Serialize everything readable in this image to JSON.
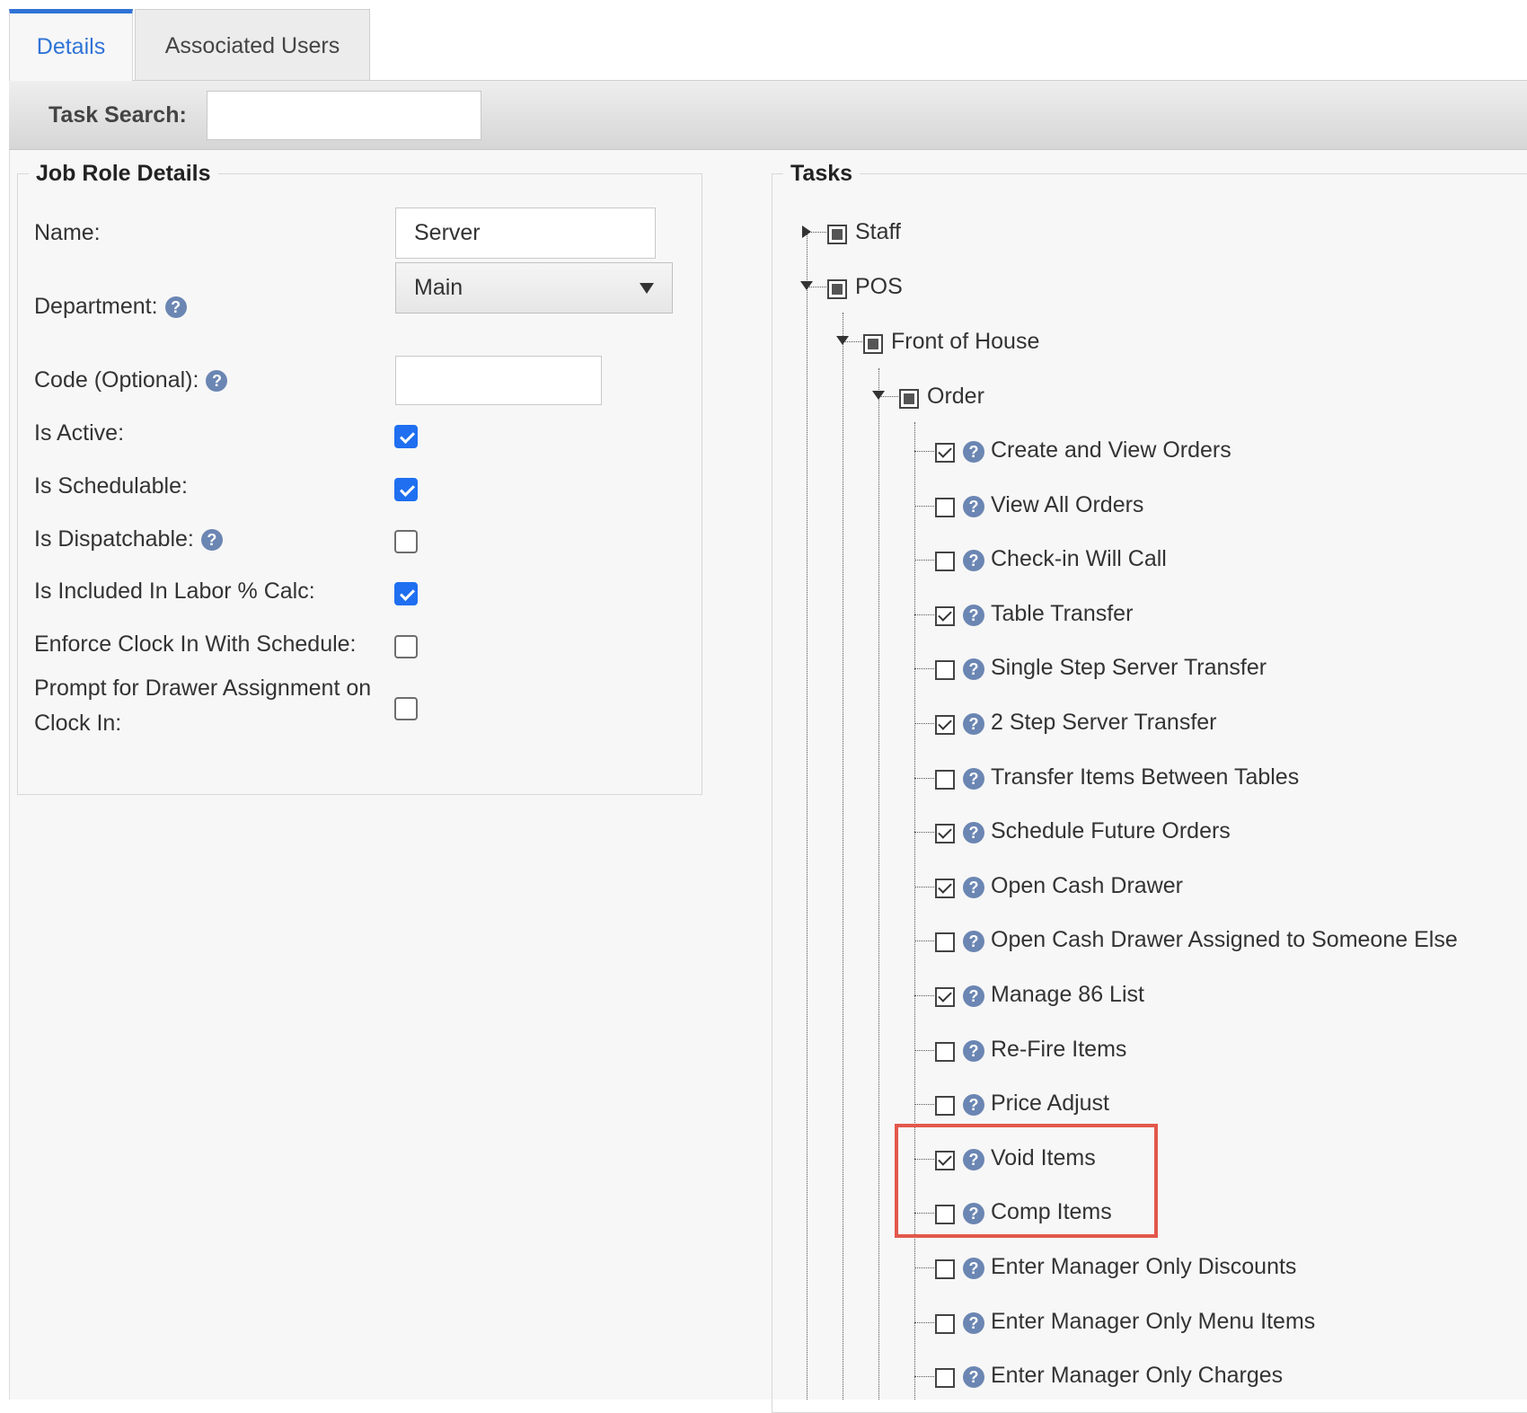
{
  "tabs": [
    {
      "label": "Details",
      "active": true
    },
    {
      "label": "Associated Users",
      "active": false
    }
  ],
  "search": {
    "label": "Task Search:",
    "value": ""
  },
  "job_role": {
    "legend": "Job Role Details",
    "name": {
      "label": "Name:",
      "value": "Server"
    },
    "department": {
      "label": "Department:",
      "value": "Main"
    },
    "code": {
      "label": "Code (Optional):",
      "value": ""
    },
    "flags": [
      {
        "label": "Is Active:",
        "checked": true
      },
      {
        "label": "Is Schedulable:",
        "checked": true
      },
      {
        "label": "Is Dispatchable:",
        "checked": false,
        "help": true
      },
      {
        "label": "Is Included In Labor % Calc:",
        "checked": true
      },
      {
        "label": "Enforce Clock In With Schedule:",
        "checked": false
      },
      {
        "label": "Prompt for Drawer Assignment on Clock In:",
        "checked": false
      }
    ]
  },
  "tasks": {
    "legend": "Tasks",
    "staff": "Staff",
    "pos": "POS",
    "front_of_house": "Front of House",
    "order": "Order",
    "items": [
      {
        "label": "Create and View Orders",
        "checked": true
      },
      {
        "label": "View All Orders",
        "checked": false
      },
      {
        "label": "Check-in Will Call",
        "checked": false
      },
      {
        "label": "Table Transfer",
        "checked": true
      },
      {
        "label": "Single Step Server Transfer",
        "checked": false
      },
      {
        "label": "2 Step Server Transfer",
        "checked": true
      },
      {
        "label": "Transfer Items Between Tables",
        "checked": false
      },
      {
        "label": "Schedule Future Orders",
        "checked": true
      },
      {
        "label": "Open Cash Drawer",
        "checked": true
      },
      {
        "label": "Open Cash Drawer Assigned to Someone Else",
        "checked": false
      },
      {
        "label": "Manage 86 List",
        "checked": true
      },
      {
        "label": "Re-Fire Items",
        "checked": false
      },
      {
        "label": "Price Adjust",
        "checked": false
      },
      {
        "label": "Void Items",
        "checked": true
      },
      {
        "label": "Comp Items",
        "checked": false
      },
      {
        "label": "Enter Manager Only Discounts",
        "checked": false
      },
      {
        "label": "Enter Manager Only Menu Items",
        "checked": false
      },
      {
        "label": "Enter Manager Only Charges",
        "checked": false
      }
    ]
  },
  "colors": {
    "accent": "#2f73d6",
    "checkbox_on": "#1f6ff0",
    "highlight": "#e3574b",
    "help_icon": "#6b86b3"
  }
}
